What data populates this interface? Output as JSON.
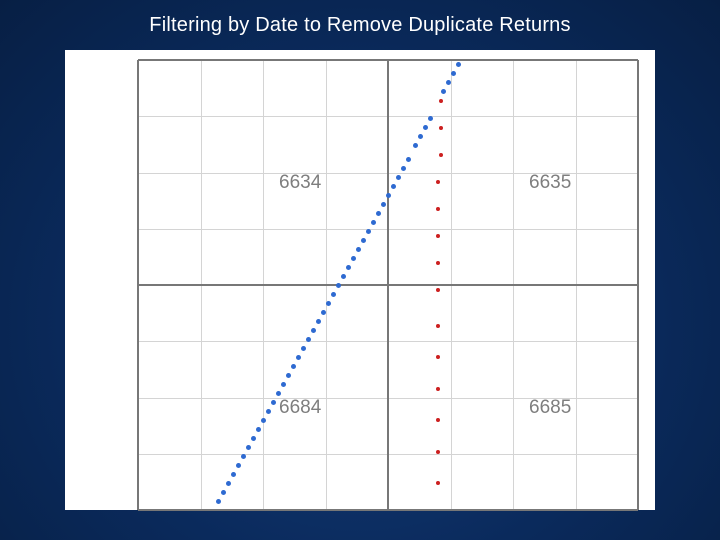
{
  "title": "Filtering by Date to Remove Duplicate Returns",
  "chart_data": {
    "type": "scatter",
    "title": "Filtering by Date to Remove Duplicate Returns",
    "xlabel": "",
    "ylabel": "",
    "xlim": [
      0,
      100
    ],
    "ylim": [
      0,
      100
    ],
    "grid": {
      "minor_x": [
        12.5,
        25,
        37.5,
        62.5,
        75,
        87.5
      ],
      "minor_y": [
        12.5,
        25,
        37.5,
        62.5,
        75,
        87.5
      ],
      "major_x": [
        0,
        50,
        100
      ],
      "major_y": [
        0,
        50,
        100
      ]
    },
    "quadrant_labels": [
      {
        "text": "6634",
        "x": 33,
        "y": 73
      },
      {
        "text": "6635",
        "x": 83,
        "y": 73
      },
      {
        "text": "6684",
        "x": 33,
        "y": 23
      },
      {
        "text": "6685",
        "x": 83,
        "y": 23
      }
    ],
    "series": [
      {
        "name": "blue",
        "color": "#2e6ad1",
        "points": [
          [
            16.0,
            2.0
          ],
          [
            17.0,
            4.0
          ],
          [
            18.0,
            6.0
          ],
          [
            19.0,
            8.0
          ],
          [
            20.0,
            10.0
          ],
          [
            21.0,
            12.0
          ],
          [
            22.0,
            14.0
          ],
          [
            23.0,
            16.0
          ],
          [
            24.0,
            18.0
          ],
          [
            25.0,
            20.0
          ],
          [
            26.0,
            22.0
          ],
          [
            27.0,
            24.0
          ],
          [
            28.0,
            26.0
          ],
          [
            29.0,
            28.0
          ],
          [
            30.0,
            30.0
          ],
          [
            31.0,
            32.0
          ],
          [
            32.0,
            34.0
          ],
          [
            33.0,
            36.0
          ],
          [
            34.0,
            38.0
          ],
          [
            35.0,
            40.0
          ],
          [
            36.0,
            42.0
          ],
          [
            37.0,
            44.0
          ],
          [
            38.0,
            46.0
          ],
          [
            39.0,
            48.0
          ],
          [
            40.0,
            50.0
          ],
          [
            41.0,
            52.0
          ],
          [
            42.0,
            54.0
          ],
          [
            43.0,
            56.0
          ],
          [
            44.0,
            58.0
          ],
          [
            45.0,
            60.0
          ],
          [
            46.0,
            62.0
          ],
          [
            47.0,
            64.0
          ],
          [
            48.0,
            66.0
          ],
          [
            49.0,
            68.0
          ],
          [
            50.0,
            70.0
          ],
          [
            51.0,
            72.0
          ],
          [
            52.0,
            74.0
          ],
          [
            53.0,
            76.0
          ],
          [
            54.0,
            78.0
          ],
          [
            55.5,
            81.0
          ],
          [
            56.5,
            83.0
          ],
          [
            57.5,
            85.0
          ],
          [
            58.5,
            87.0
          ],
          [
            61.0,
            93.0
          ],
          [
            62.0,
            95.0
          ],
          [
            63.0,
            97.0
          ],
          [
            64.0,
            99.0
          ]
        ]
      },
      {
        "name": "red",
        "color": "#cc2020",
        "points": [
          [
            60.5,
            91.0
          ],
          [
            60.5,
            85.0
          ],
          [
            60.5,
            79.0
          ],
          [
            60.0,
            73.0
          ],
          [
            60.0,
            67.0
          ],
          [
            60.0,
            61.0
          ],
          [
            60.0,
            55.0
          ],
          [
            60.0,
            49.0
          ],
          [
            60.0,
            41.0
          ],
          [
            60.0,
            34.0
          ],
          [
            60.0,
            27.0
          ],
          [
            60.0,
            20.0
          ],
          [
            60.0,
            13.0
          ],
          [
            60.0,
            6.0
          ]
        ]
      }
    ]
  }
}
